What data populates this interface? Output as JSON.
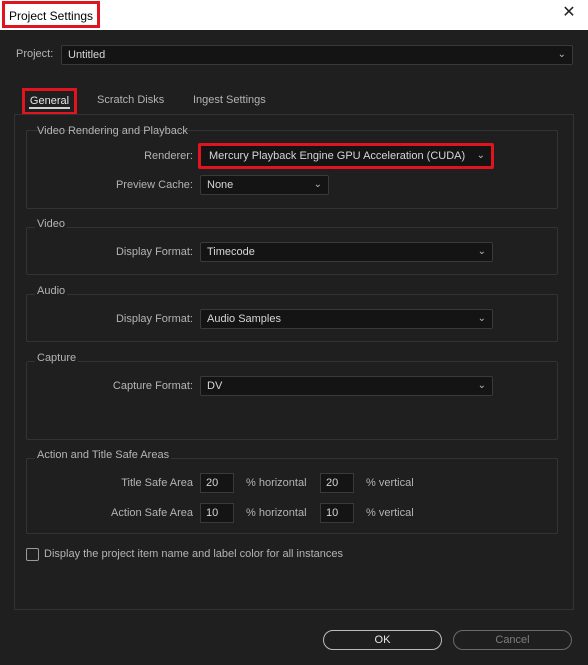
{
  "window": {
    "title": "Project Settings",
    "close_glyph": "✕"
  },
  "project": {
    "label": "Project:",
    "value": "Untitled"
  },
  "tabs": [
    {
      "label": "General"
    },
    {
      "label": "Scratch Disks"
    },
    {
      "label": "Ingest Settings"
    }
  ],
  "video_rendering": {
    "title": "Video Rendering and Playback",
    "renderer_label": "Renderer:",
    "renderer_value": "Mercury Playback Engine GPU Acceleration (CUDA)",
    "preview_cache_label": "Preview Cache:",
    "preview_cache_value": "None"
  },
  "video": {
    "title": "Video",
    "display_format_label": "Display Format:",
    "display_format_value": "Timecode"
  },
  "audio": {
    "title": "Audio",
    "display_format_label": "Display Format:",
    "display_format_value": "Audio Samples"
  },
  "capture": {
    "title": "Capture",
    "capture_format_label": "Capture Format:",
    "capture_format_value": "DV"
  },
  "safe_areas": {
    "title": "Action and Title Safe Areas",
    "title_safe_label": "Title Safe Area",
    "title_safe_h": "20",
    "title_safe_v": "20",
    "action_safe_label": "Action Safe Area",
    "action_safe_h": "10",
    "action_safe_v": "10",
    "horizontal_label": "% horizontal",
    "vertical_label": "% vertical"
  },
  "checkbox": {
    "label": "Display the project item name and label color for all instances",
    "checked": false
  },
  "buttons": {
    "ok": "OK",
    "cancel": "Cancel"
  },
  "colors": {
    "highlight": "#e0141e",
    "background": "#1f1f1f"
  },
  "icons": {
    "dropdown": "chevron-down-icon",
    "close": "close-icon"
  }
}
